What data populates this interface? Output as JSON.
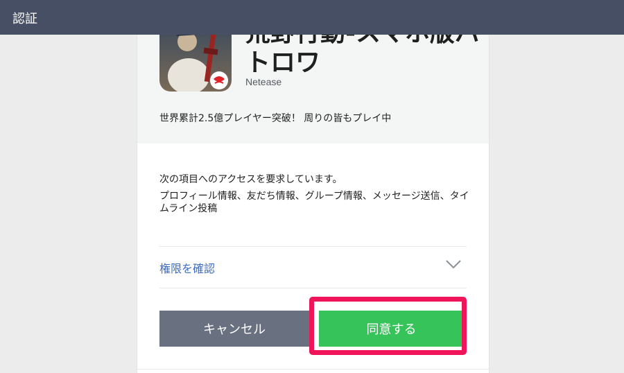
{
  "header": {
    "title": "認証"
  },
  "app": {
    "name_line1": "荒野行動-スマホ版バ",
    "name_line2": "トロワ",
    "developer": "Netease",
    "description": "世界累計2.5億プレイヤー突破！ 周りの皆もプレイ中",
    "icon": "game-app-icon"
  },
  "permissions": {
    "title": "次の項目へのアクセスを要求しています。",
    "list": "プロフィール情報、友だち情報、グループ情報、メッセージ送信、タイムライン投稿",
    "confirm_label": "権限を確認",
    "confirm_icon": "chevron-down-icon"
  },
  "actions": {
    "cancel_label": "キャンセル",
    "agree_label": "同意する"
  },
  "colors": {
    "header": "#474f64",
    "cancel": "#697080",
    "agree": "#36c45a",
    "highlight": "#f0145a",
    "link": "#3b6cc0"
  }
}
